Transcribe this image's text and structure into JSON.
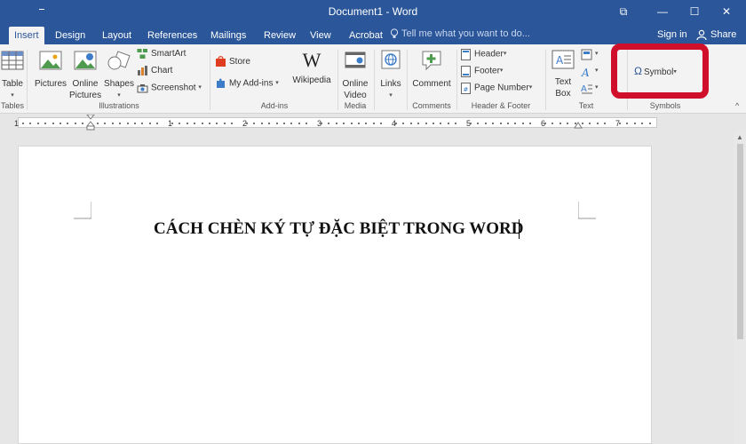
{
  "titlebar": {
    "title": "Document1 - Word",
    "restore_glyph": "⧉",
    "minimize_glyph": "—",
    "maximize_glyph": "☐",
    "close_glyph": "✕"
  },
  "tabs": [
    {
      "label": "Insert",
      "active": true
    },
    {
      "label": "Design"
    },
    {
      "label": "Layout"
    },
    {
      "label": "References"
    },
    {
      "label": "Mailings"
    },
    {
      "label": "Review"
    },
    {
      "label": "View"
    },
    {
      "label": "Acrobat"
    }
  ],
  "tell_me": "Tell me what you want to do...",
  "account": {
    "signin": "Sign in",
    "share": "Share"
  },
  "ribbon": {
    "tables": {
      "button": "Table",
      "group": "Tables"
    },
    "illustrations": {
      "pictures": "Pictures",
      "online_pictures_1": "Online",
      "online_pictures_2": "Pictures",
      "shapes": "Shapes",
      "smartart": "SmartArt",
      "chart": "Chart",
      "screenshot": "Screenshot",
      "group": "Illustrations"
    },
    "addins": {
      "store": "Store",
      "my_addins": "My Add-ins",
      "wikipedia": "Wikipedia",
      "wiki_glyph": "W",
      "group": "Add-ins"
    },
    "media": {
      "online_video_1": "Online",
      "online_video_2": "Video",
      "group": "Media"
    },
    "links": {
      "button": "Links"
    },
    "comments": {
      "button": "Comment",
      "group": "Comments"
    },
    "header_footer": {
      "header": "Header",
      "footer": "Footer",
      "page_number": "Page Number",
      "group": "Header & Footer"
    },
    "text": {
      "textbox_1": "Text",
      "textbox_2": "Box",
      "group": "Text"
    },
    "symbols": {
      "symbol": "Symbol",
      "omega": "Ω",
      "group": "Symbols"
    }
  },
  "ruler": {
    "numbers": [
      "1",
      "1",
      "2",
      "3",
      "4",
      "5",
      "6",
      "7"
    ]
  },
  "document": {
    "heading": "CÁCH CHÈN KÝ TỰ ĐẶC BIỆT TRONG WORD"
  },
  "colors": {
    "brand": "#2b579a",
    "highlight": "#d0102b"
  }
}
